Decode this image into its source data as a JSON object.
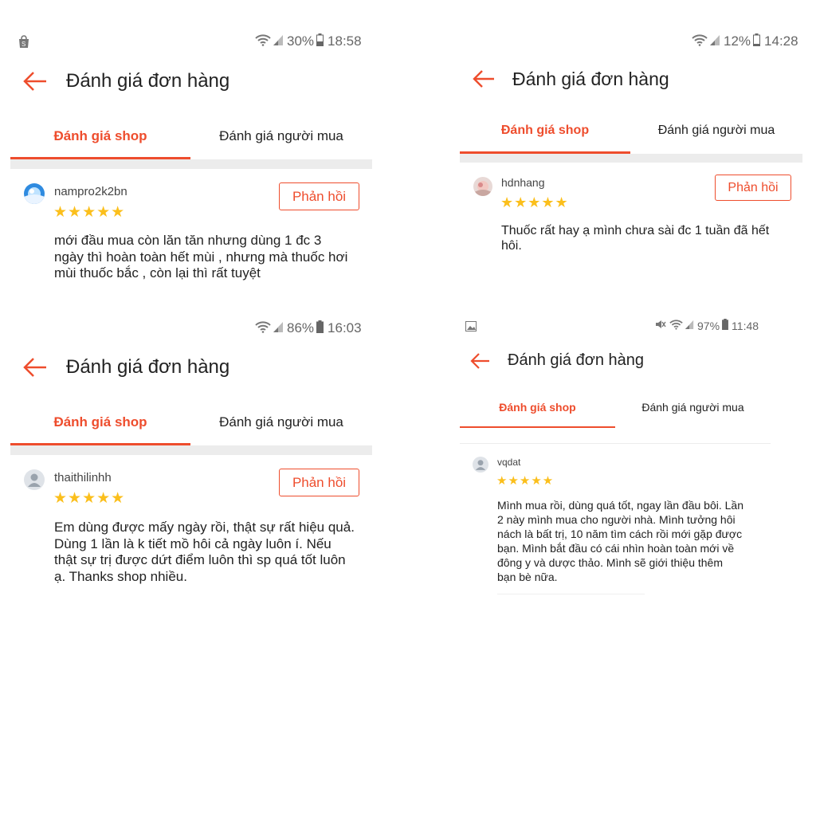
{
  "panels": [
    {
      "status": {
        "battery": "30%",
        "time": "18:58"
      },
      "title": "Đánh giá đơn hàng",
      "tabs": [
        "Đánh giá shop",
        "Đánh giá người mua"
      ],
      "review": {
        "username": "nampro2k2bn",
        "rating": 5,
        "stars": "★★★★★",
        "reply_label": "Phản hồi",
        "comment_lines": [
          "mới đầu mua còn lăn tăn nhưng dùng 1 đc 3",
          "ngày thì hoàn toàn hết mùi , nhưng mà thuốc hơi",
          "mùi thuốc bắc , còn lại thì rất tuyệt"
        ]
      }
    },
    {
      "status": {
        "battery": "12%",
        "time": "14:28"
      },
      "title": "Đánh giá đơn hàng",
      "tabs": [
        "Đánh giá shop",
        "Đánh giá người mua"
      ],
      "review": {
        "username": "hdnhang",
        "rating": 5,
        "stars": "★★★★★",
        "reply_label": "Phản hồi",
        "comment_lines": [
          "Thuốc rất hay ạ mình chưa sài đc 1 tuần đã hết",
          "hôi."
        ]
      }
    },
    {
      "status": {
        "battery": "86%",
        "time": "16:03"
      },
      "title": "Đánh giá đơn hàng",
      "tabs": [
        "Đánh giá shop",
        "Đánh giá người mua"
      ],
      "review": {
        "username": "thaithilinhh",
        "rating": 5,
        "stars": "★★★★★",
        "reply_label": "Phản hồi",
        "comment_lines": [
          "Em dùng được mấy ngày rồi, thật sự rất hiệu quả.",
          "Dùng 1 lần là k tiết mồ hôi cả ngày luôn í. Nếu",
          "thật sự trị được dứt điểm luôn thì sp quá tốt luôn",
          "ạ. Thanks shop nhiều."
        ]
      }
    },
    {
      "status": {
        "battery": "97%",
        "time": "11:48"
      },
      "title": "Đánh giá đơn hàng",
      "tabs": [
        "Đánh giá shop",
        "Đánh giá người mua"
      ],
      "review": {
        "username": "vqdat",
        "rating": 5,
        "stars": "★★★★★",
        "comment_lines": [
          "Mình mua rồi, dùng quá tốt, ngay lần đầu bôi. Lần",
          "2 này mình mua cho người nhà. Mình tưởng hôi",
          "nách là bất trị, 10 năm tìm cách rồi mới gặp được",
          "bạn. Mình bắt đầu có cái nhìn hoàn toàn mới về",
          "đông y và dược thảo. Mình sẽ giới thiệu thêm",
          "bạn bè nữa."
        ]
      }
    }
  ]
}
